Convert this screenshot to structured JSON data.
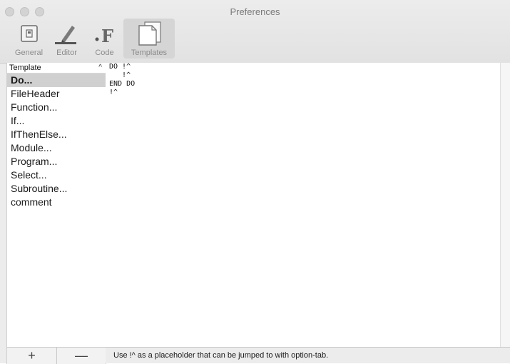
{
  "window": {
    "title": "Preferences"
  },
  "toolbar": {
    "tabs": [
      {
        "label": "General",
        "icon": "switch-icon"
      },
      {
        "label": "Editor",
        "icon": "pencil-icon"
      },
      {
        "label": "Code",
        "icon": "dot-f-icon"
      },
      {
        "label": "Templates",
        "icon": "document-stack-icon"
      }
    ],
    "active": "Templates"
  },
  "sidebar": {
    "header": "Template",
    "items": [
      {
        "label": "Do..."
      },
      {
        "label": "FileHeader"
      },
      {
        "label": "Function..."
      },
      {
        "label": "If..."
      },
      {
        "label": "IfThenElse..."
      },
      {
        "label": "Module..."
      },
      {
        "label": "Program..."
      },
      {
        "label": "Select..."
      },
      {
        "label": "Subroutine..."
      },
      {
        "label": "comment"
      }
    ],
    "selected": "Do...",
    "add_label": "+",
    "remove_label": "—"
  },
  "editor": {
    "lines": [
      "DO !^",
      "   !^",
      "END DO",
      "!^"
    ]
  },
  "status": {
    "text": "Use !^ as a placeholder that can be jumped to with option-tab."
  }
}
